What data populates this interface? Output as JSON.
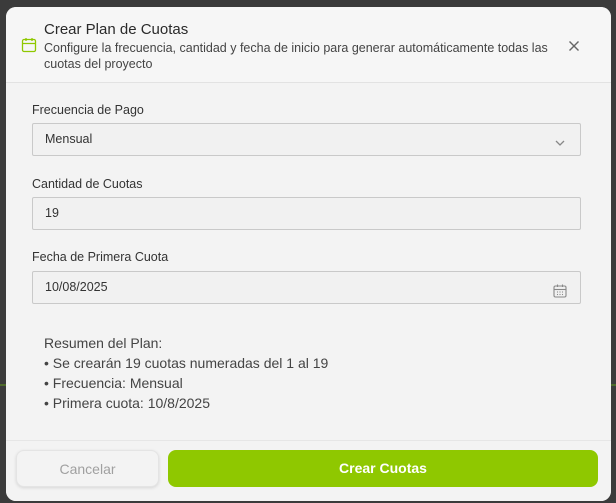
{
  "dialog": {
    "title": "Crear Plan de Cuotas",
    "subtitle": "Configure la frecuencia, cantidad y fecha de inicio para generar automáticamente todas las cuotas del proyecto",
    "accent_color": "#8fc800"
  },
  "form": {
    "frequency": {
      "label": "Frecuencia de Pago",
      "value": "Mensual"
    },
    "quantity": {
      "label": "Cantidad de Cuotas",
      "value": "19"
    },
    "first_date": {
      "label": "Fecha de Primera Cuota",
      "value": "10/08/2025"
    }
  },
  "summary": {
    "title": "Resumen del Plan:",
    "items": [
      "• Se crearán 19 cuotas numeradas del 1 al 19",
      "• Frecuencia: Mensual",
      "• Primera cuota: 10/8/2025"
    ]
  },
  "footer": {
    "cancel_label": "Cancelar",
    "create_label": "Crear Cuotas"
  },
  "icons": {
    "header": "calendar-icon",
    "close": "close-icon",
    "select": "chevron-down-icon",
    "date": "calendar-icon"
  }
}
